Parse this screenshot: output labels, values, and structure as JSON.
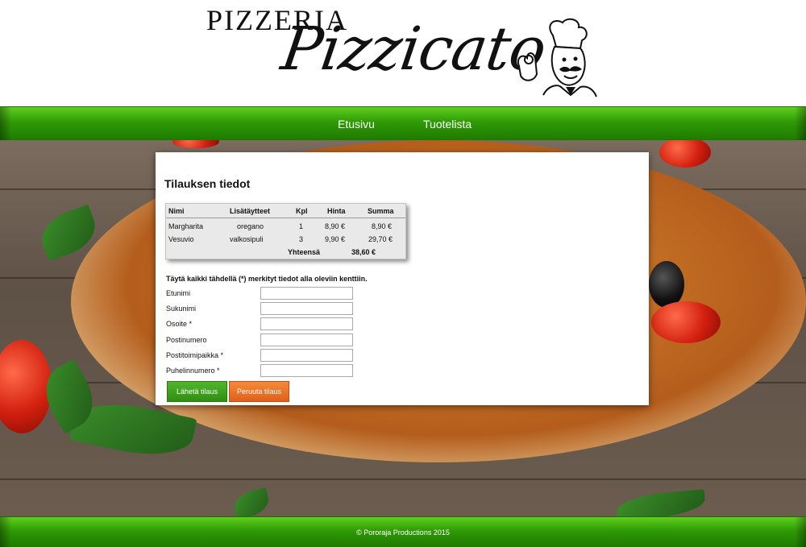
{
  "logo": {
    "line1": "PIZZERIA",
    "line2": "Pizzicato"
  },
  "nav": {
    "items": [
      {
        "label": "Etusivu"
      },
      {
        "label": "Tuotelista"
      }
    ]
  },
  "order": {
    "title": "Tilauksen tiedot",
    "headers": {
      "nimi": "Nimi",
      "lisataytteet": "Lisätäytteet",
      "kpl": "Kpl",
      "hinta": "Hinta",
      "summa": "Summa"
    },
    "rows": [
      {
        "nimi": "Margharita",
        "lisataytteet": "oregano",
        "kpl": "1",
        "hinta": "8,90 €",
        "summa": "8,90 €"
      },
      {
        "nimi": "Vesuvio",
        "lisataytteet": "valkosipuli",
        "kpl": "3",
        "hinta": "9,90 €",
        "summa": "29,70 €"
      }
    ],
    "total_label": "Yhteensä",
    "total_value": "38,60 €"
  },
  "form": {
    "instructions": "Täytä kaikki tähdellä (*) merkityt tiedot alla oleviin kenttiin.",
    "fields": [
      {
        "label": "Etunimi",
        "value": ""
      },
      {
        "label": "Sukunimi",
        "value": ""
      },
      {
        "label": "Osoite *",
        "value": ""
      },
      {
        "label": "Postinumero",
        "value": ""
      },
      {
        "label": "Postitoimipaikka *",
        "value": ""
      },
      {
        "label": "Puhelinnumero *",
        "value": ""
      }
    ],
    "submit_label": "Lähetä tilaus",
    "cancel_label": "Peruuta tilaus"
  },
  "footer": {
    "text": "© Pororaja Productions 2015"
  },
  "colors": {
    "nav_green": "#2f9a06",
    "submit_green": "#3fa01e",
    "cancel_orange": "#e8702a"
  },
  "icons": {
    "chef": "chef-mascot-icon"
  }
}
